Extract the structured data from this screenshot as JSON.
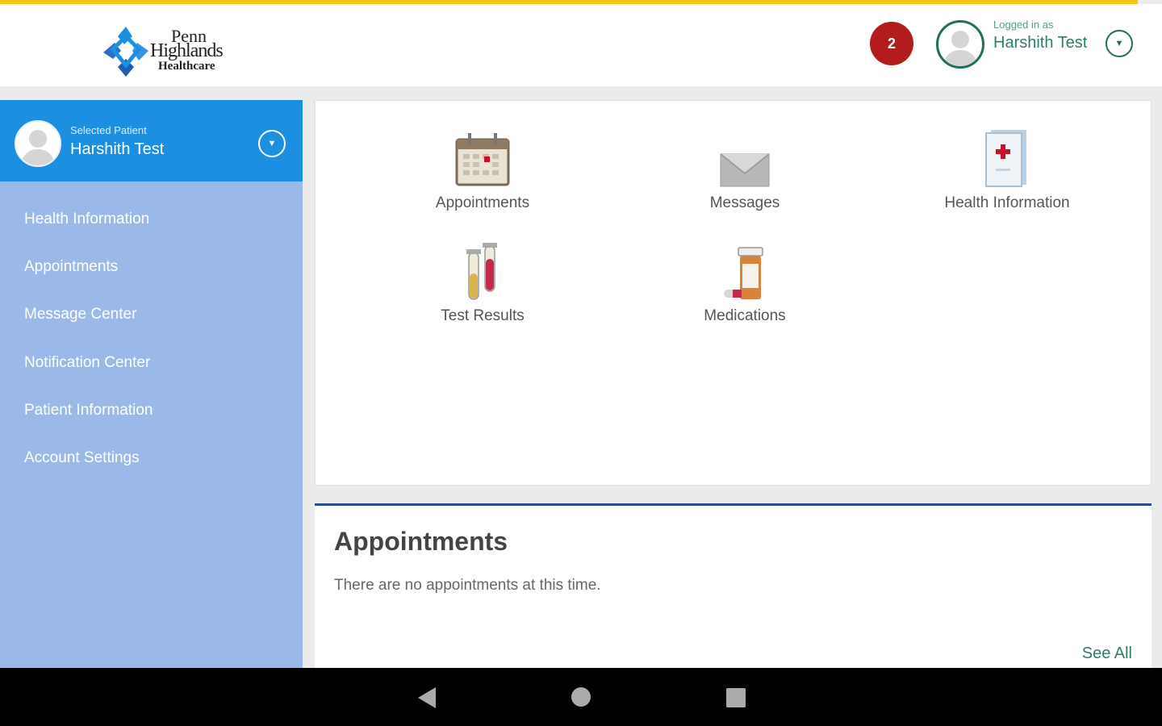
{
  "header": {
    "logo": {
      "line1": "Penn",
      "line2": "Highlands",
      "line3": "Healthcare"
    },
    "notification_count": "2",
    "logged_in_label": "Logged in as",
    "user_name": "Harshith Test"
  },
  "sidebar": {
    "selected_patient_label": "Selected Patient",
    "patient_name": "Harshith Test",
    "items": [
      {
        "label": "Health Information"
      },
      {
        "label": "Appointments"
      },
      {
        "label": "Message Center"
      },
      {
        "label": "Notification Center"
      },
      {
        "label": "Patient Information"
      },
      {
        "label": "Account Settings"
      }
    ]
  },
  "tiles": [
    {
      "label": "Appointments",
      "icon": "calendar-icon"
    },
    {
      "label": "Messages",
      "icon": "envelope-icon"
    },
    {
      "label": "Health Information",
      "icon": "medical-folder-icon"
    },
    {
      "label": "Test Results",
      "icon": "test-tubes-icon"
    },
    {
      "label": "Medications",
      "icon": "pill-bottle-icon"
    }
  ],
  "appointments_panel": {
    "title": "Appointments",
    "empty_message": "There are no appointments at this time.",
    "see_all_label": "See All"
  },
  "colors": {
    "loader": "#f5c518",
    "patient_header": "#1c8fe0",
    "sidebar": "#9ab9e8",
    "badge": "#b31c1c",
    "accent_green": "#2e7d6b",
    "panel_border": "#2b4d8f"
  }
}
